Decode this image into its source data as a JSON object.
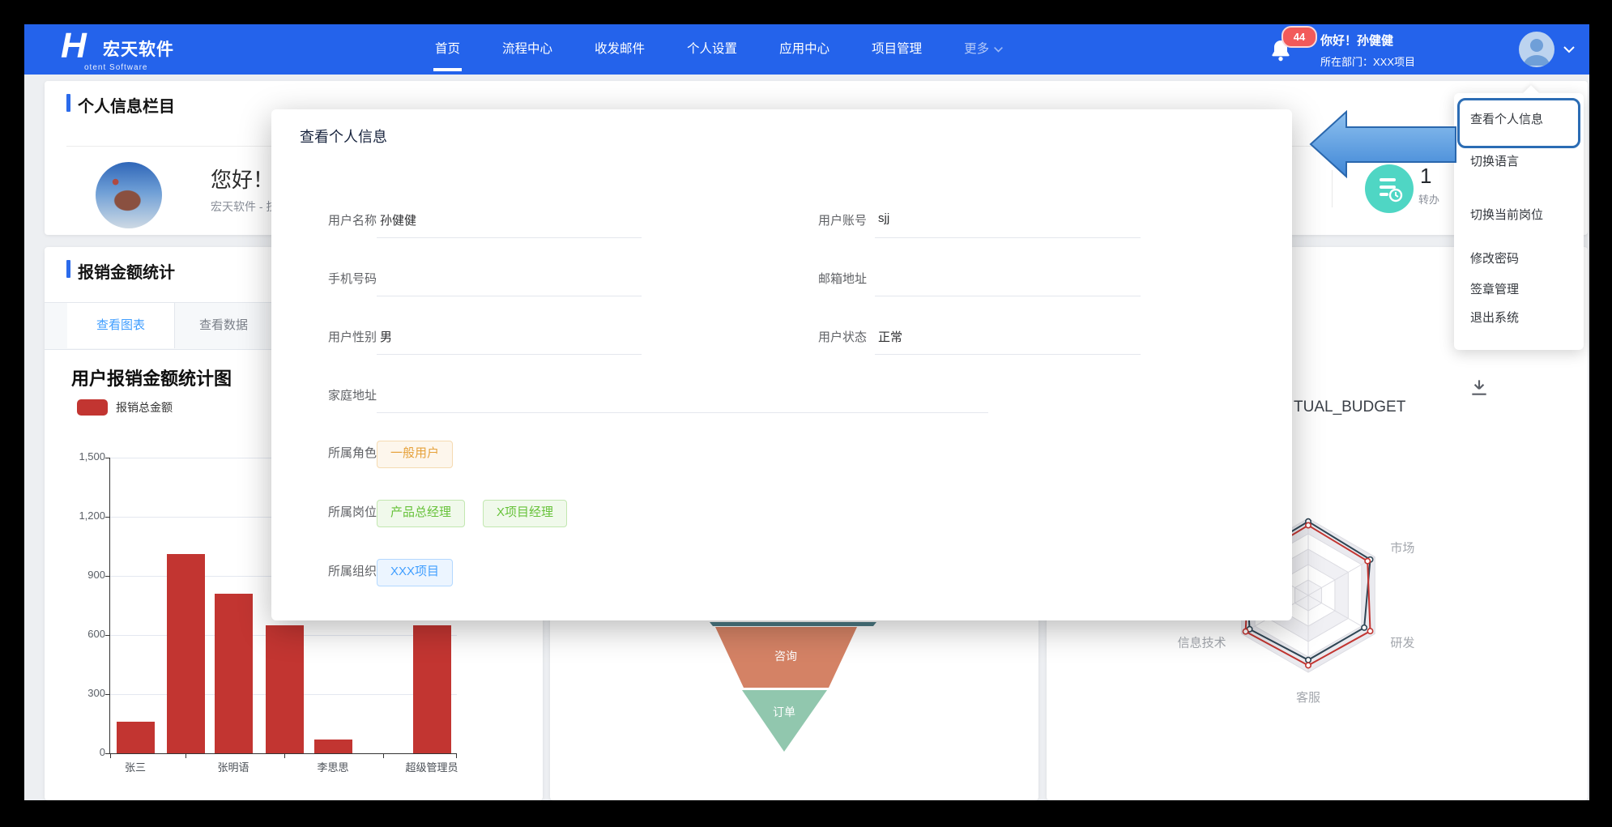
{
  "nav": {
    "brand": {
      "mark": "H",
      "name": "宏天软件",
      "subtitle": "otent Software"
    },
    "items": [
      {
        "label": "首页",
        "active": true
      },
      {
        "label": "流程中心"
      },
      {
        "label": "收发邮件"
      },
      {
        "label": "个人设置"
      },
      {
        "label": "应用中心"
      },
      {
        "label": "项目管理"
      },
      {
        "label": "更多",
        "caret": true,
        "dimmed": true
      }
    ],
    "notification_count": "44",
    "greeting": "你好！孙健健",
    "department": "所在部门：XXX项目",
    "colors": {
      "bar": "#2463eb",
      "badge": "#f25a5a"
    }
  },
  "user_menu": {
    "items": [
      {
        "label": "查看个人信息",
        "highlighted": true
      },
      {
        "label": "切换语言"
      },
      {
        "label": "切换当前岗位"
      },
      {
        "label": "修改密码"
      },
      {
        "label": "签章管理"
      },
      {
        "label": "退出系统"
      }
    ]
  },
  "profile_card": {
    "title": "个人信息栏目",
    "greeting": "您好！孙健健",
    "org_line": "宏天软件 - 技术部 - 开",
    "stat": {
      "value": "1",
      "label": "转办",
      "icon_color": "#4fd6c4"
    }
  },
  "expense_card": {
    "title": "报销金额统计",
    "tabs": [
      {
        "label": "查看图表",
        "active": true
      },
      {
        "label": "查看数据"
      }
    ]
  },
  "right_card": {
    "title_fragment": "TUAL_BUDGET"
  },
  "modal": {
    "title": "查看个人信息",
    "rows": [
      {
        "fields": [
          {
            "col": "left",
            "label": "用户名称",
            "value": "孙健健"
          },
          {
            "col": "right",
            "label": "用户账号",
            "value": "sjj"
          }
        ]
      },
      {
        "fields": [
          {
            "col": "left",
            "label": "手机号码",
            "value": ""
          },
          {
            "col": "right",
            "label": "邮箱地址",
            "value": ""
          }
        ]
      },
      {
        "fields": [
          {
            "col": "left",
            "label": "用户性别",
            "value": "男"
          },
          {
            "col": "right",
            "label": "用户状态",
            "value": "正常"
          }
        ]
      },
      {
        "fields": [
          {
            "col": "left",
            "label": "家庭地址",
            "value": "",
            "wide": true
          }
        ]
      },
      {
        "fields": [
          {
            "col": "left",
            "label": "所属角色",
            "tags": [
              {
                "text": "一般用户",
                "variant": "warning"
              }
            ]
          }
        ]
      },
      {
        "fields": [
          {
            "col": "left",
            "label": "所属岗位",
            "tags": [
              {
                "text": "产品总经理",
                "variant": "success"
              },
              {
                "text": "X项目经理",
                "variant": "success"
              }
            ]
          }
        ]
      },
      {
        "fields": [
          {
            "col": "left",
            "label": "所属组织",
            "tags": [
              {
                "text": "XXX项目",
                "variant": "primary"
              }
            ]
          }
        ]
      }
    ]
  },
  "chart_data": [
    {
      "type": "bar",
      "title": "用户报销金额统计图",
      "legend": [
        "报销总金额"
      ],
      "categories": [
        "张三",
        "",
        "张明语",
        "",
        "李思思",
        "",
        "超级管理员"
      ],
      "values": [
        160,
        1010,
        810,
        650,
        70,
        0,
        650
      ],
      "xlabel": "",
      "ylabel": "",
      "ylim": [
        0,
        1500
      ],
      "yticks": [
        0,
        300,
        600,
        900,
        1200,
        1500
      ],
      "color": "#c23531",
      "grid": true
    },
    {
      "type": "funnel",
      "segments": [
        {
          "label": "咨询",
          "color": "#d48265"
        },
        {
          "label": "订单",
          "color": "#91c7ae"
        }
      ],
      "occluded_segment_color": "#4c7a84"
    },
    {
      "type": "radar",
      "title_fragment": "TUAL_BUDGET",
      "axes": [
        "",
        "市场",
        "研发",
        "客服",
        "信息技术",
        ""
      ],
      "max": 100,
      "series": [
        {
          "name": "navy",
          "color": "#2f4554",
          "values": [
            96,
            93,
            84,
            84,
            88,
            94
          ]
        },
        {
          "name": "red",
          "color": "#c23531",
          "values": [
            91,
            89,
            93,
            91,
            94,
            89
          ]
        }
      ]
    }
  ]
}
